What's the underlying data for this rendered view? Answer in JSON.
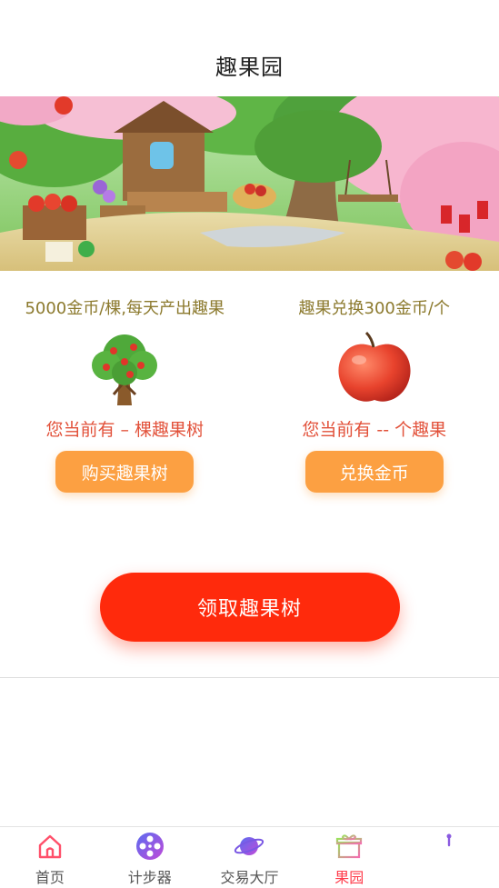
{
  "header": {
    "title": "趣果园"
  },
  "cards": [
    {
      "desc": "5000金币/棵,每天产出趣果",
      "owned_prefix": "您当前有",
      "owned_count": "–",
      "owned_suffix": "棵趣果树",
      "button": "购买趣果树",
      "icon": "tree-icon"
    },
    {
      "desc": "趣果兑换300金币/个",
      "owned_prefix": "您当前有",
      "owned_count": "--",
      "owned_suffix": "个趣果",
      "button": "兑换金币",
      "icon": "apple-icon"
    }
  ],
  "claim_button": "领取趣果树",
  "tabs": [
    {
      "label": "首页",
      "icon": "home-icon"
    },
    {
      "label": "计步器",
      "icon": "film-reel-icon"
    },
    {
      "label": "交易大厅",
      "icon": "planet-icon"
    },
    {
      "label": "果园",
      "icon": "gift-icon",
      "active": true
    },
    {
      "label": "",
      "icon": "profile-icon"
    }
  ],
  "colors": {
    "desc_text": "#8c7a2e",
    "owned_text": "#e2513a",
    "card_button": "#fca042",
    "claim_button": "#ff2a0c",
    "active_tab": "#ff3c4b"
  }
}
